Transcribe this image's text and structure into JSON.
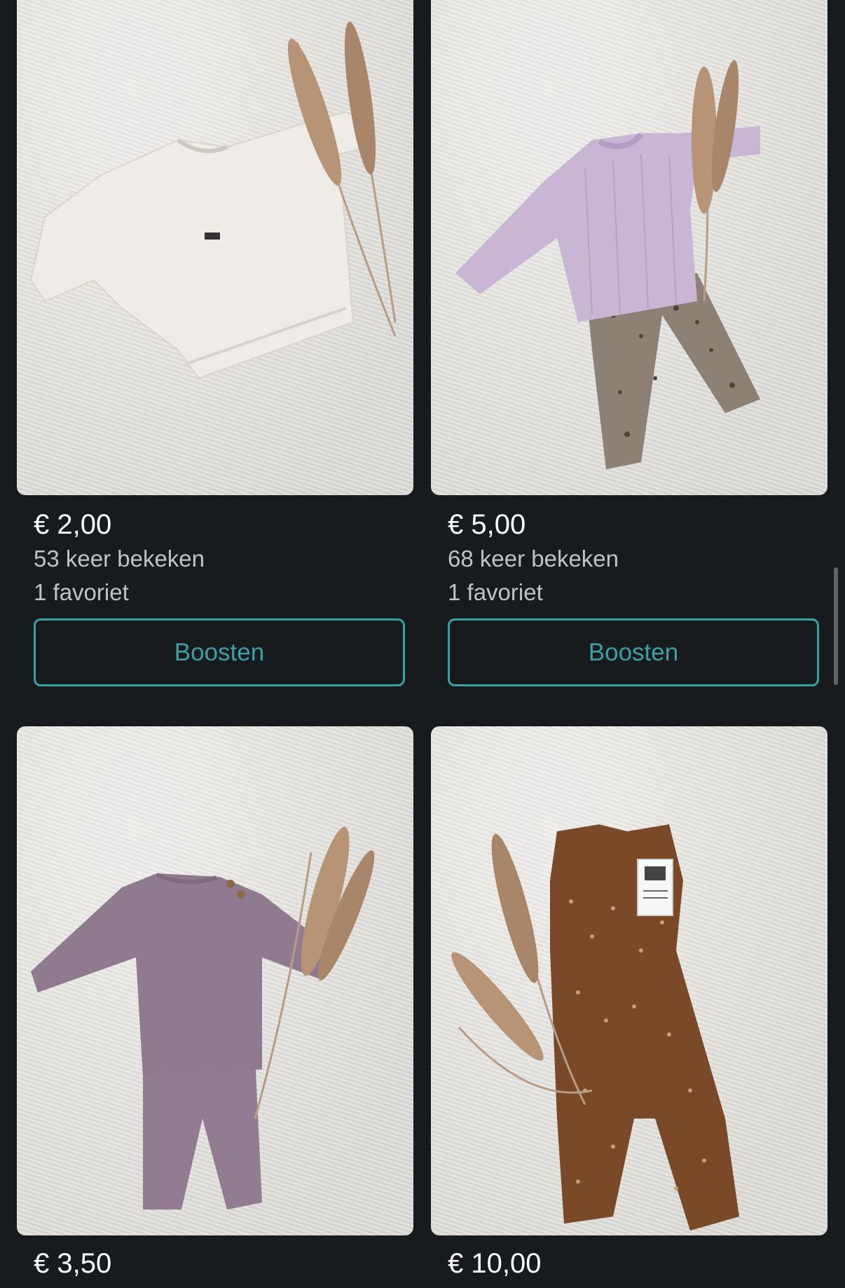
{
  "listings": [
    {
      "price": "€ 2,00",
      "views": "53 keer bekeken",
      "favorites": "1 favoriet",
      "boost_label": "Boosten",
      "image": "white sweatshirt with pampas grass"
    },
    {
      "price": "€ 5,00",
      "views": "68 keer bekeken",
      "favorites": "1 favoriet",
      "boost_label": "Boosten",
      "image": "lilac ribbed top with floral leggings and pampas grass"
    },
    {
      "price": "€ 3,50",
      "image": "mauve top and pants set with pampas grass"
    },
    {
      "price": "€ 10,00",
      "image": "brown floral jumpsuit with tag and pampas grass"
    }
  ],
  "colors": {
    "background": "#171b1d",
    "accent": "#3aa0a8",
    "muted_text": "#bfc3c5"
  }
}
